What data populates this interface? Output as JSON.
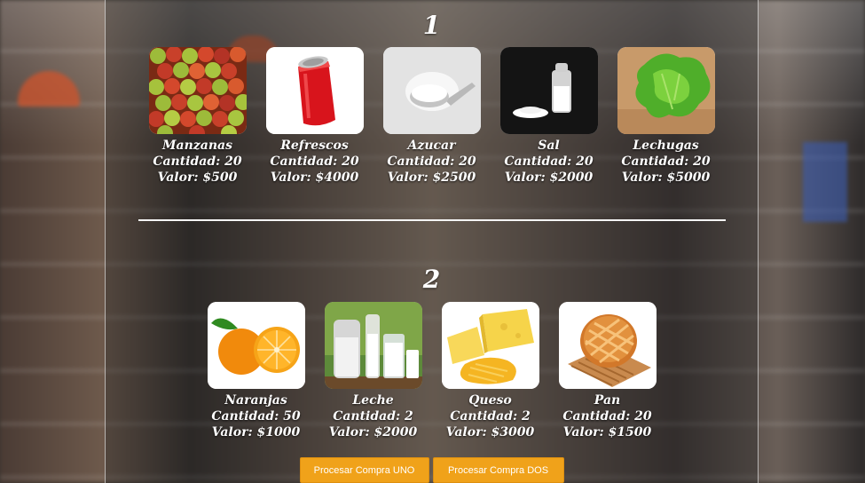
{
  "section1": {
    "number": "1",
    "products": [
      {
        "image_icon": "apples-image",
        "name": "Manzanas",
        "quantity": "Cantidad: 20",
        "value": "Valor: $500"
      },
      {
        "image_icon": "soda-can-image",
        "name": "Refrescos",
        "quantity": "Cantidad: 20",
        "value": "Valor: $4000"
      },
      {
        "image_icon": "sugar-image",
        "name": "Azucar",
        "quantity": "Cantidad: 20",
        "value": "Valor: $2500"
      },
      {
        "image_icon": "salt-image",
        "name": "Sal",
        "quantity": "Cantidad: 20",
        "value": "Valor: $2000"
      },
      {
        "image_icon": "lettuce-image",
        "name": "Lechugas",
        "quantity": "Cantidad: 20",
        "value": "Valor: $5000"
      }
    ]
  },
  "section2": {
    "number": "2",
    "products": [
      {
        "image_icon": "orange-image",
        "name": "Naranjas",
        "quantity": "Cantidad: 50",
        "value": "Valor: $1000"
      },
      {
        "image_icon": "milk-image",
        "name": "Leche",
        "quantity": "Cantidad: 2",
        "value": "Valor: $2000"
      },
      {
        "image_icon": "cheese-image",
        "name": "Queso",
        "quantity": "Cantidad: 2",
        "value": "Valor: $3000"
      },
      {
        "image_icon": "bread-image",
        "name": "Pan",
        "quantity": "Cantidad: 20",
        "value": "Valor: $1500"
      }
    ]
  },
  "buttons": {
    "process_one": "Procesar Compra UNO",
    "process_two": "Procesar Compra DOS"
  },
  "colors": {
    "button": "#f0a21a",
    "text": "#ffffff"
  }
}
